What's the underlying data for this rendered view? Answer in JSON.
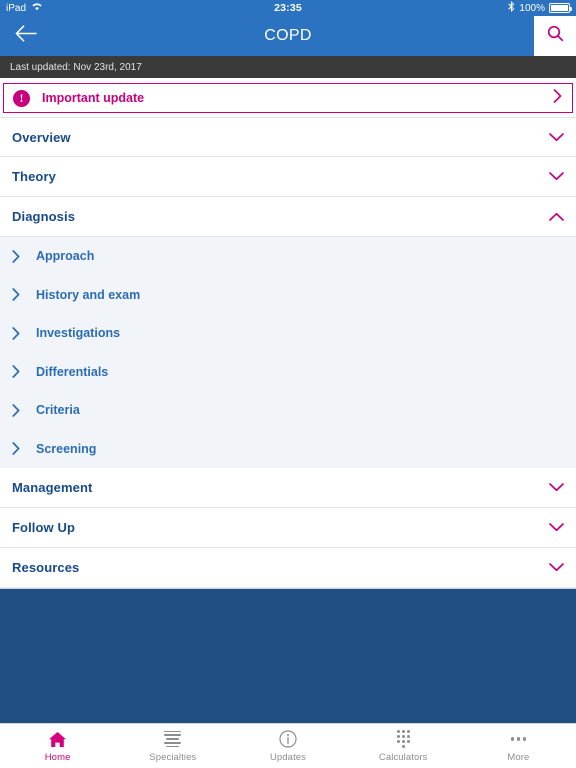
{
  "status_bar": {
    "device": "iPad",
    "wifi_icon": "wifi-icon",
    "time": "23:35",
    "bluetooth_icon": "bluetooth-icon",
    "battery_percent": "100%",
    "battery_icon": "battery-full-icon"
  },
  "nav_bar": {
    "back_icon": "back-arrow-icon",
    "title": "COPD",
    "search_icon": "search-icon"
  },
  "meta_bar": {
    "last_updated": "Last updated: Nov 23rd, 2017"
  },
  "important_update": {
    "icon": "exclamation-circle-icon",
    "label": "Important update",
    "chevron_icon": "chevron-right-icon"
  },
  "sections": [
    {
      "label": "Overview",
      "expanded": false,
      "chevron_icon": "chevron-down-icon",
      "items": []
    },
    {
      "label": "Theory",
      "expanded": false,
      "chevron_icon": "chevron-down-icon",
      "items": []
    },
    {
      "label": "Diagnosis",
      "expanded": true,
      "chevron_icon": "chevron-up-icon",
      "items": [
        {
          "label": "Approach",
          "chevron_icon": "chevron-right-icon"
        },
        {
          "label": "History and exam",
          "chevron_icon": "chevron-right-icon"
        },
        {
          "label": "Investigations",
          "chevron_icon": "chevron-right-icon"
        },
        {
          "label": "Differentials",
          "chevron_icon": "chevron-right-icon"
        },
        {
          "label": "Criteria",
          "chevron_icon": "chevron-right-icon"
        },
        {
          "label": "Screening",
          "chevron_icon": "chevron-right-icon"
        }
      ]
    },
    {
      "label": "Management",
      "expanded": false,
      "chevron_icon": "chevron-down-icon",
      "items": []
    },
    {
      "label": "Follow Up",
      "expanded": false,
      "chevron_icon": "chevron-down-icon",
      "items": []
    },
    {
      "label": "Resources",
      "expanded": false,
      "chevron_icon": "chevron-down-icon",
      "items": []
    }
  ],
  "tab_bar": {
    "tabs": [
      {
        "label": "Home",
        "icon": "home-icon",
        "active": true
      },
      {
        "label": "Specialties",
        "icon": "list-icon",
        "active": false
      },
      {
        "label": "Updates",
        "icon": "info-icon",
        "active": false
      },
      {
        "label": "Calculators",
        "icon": "keypad-icon",
        "active": false
      },
      {
        "label": "More",
        "icon": "ellipsis-icon",
        "active": false
      }
    ]
  },
  "colors": {
    "nav_blue": "#2b72c0",
    "deep_blue": "#1f4e82",
    "accent_magenta": "#c9007e",
    "tab_active": "#d6007f",
    "section_title": "#174a8b",
    "sub_item_bg": "#f1f5f9",
    "meta_bar_bg": "#3a3a3a"
  }
}
